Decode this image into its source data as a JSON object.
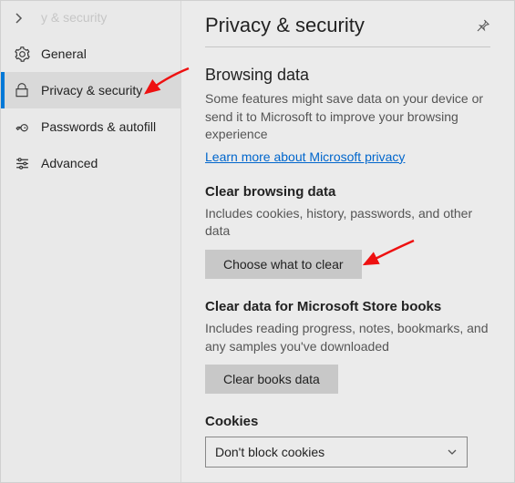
{
  "sidebar": {
    "ghost_title": "y & security",
    "items": [
      {
        "label": "General"
      },
      {
        "label": "Privacy & security"
      },
      {
        "label": "Passwords & autofill"
      },
      {
        "label": "Advanced"
      }
    ]
  },
  "header": {
    "title": "Privacy & security"
  },
  "browsing": {
    "heading": "Browsing data",
    "description": "Some features might save data on your device or send it to Microsoft to improve your browsing experience",
    "link": "Learn more about Microsoft privacy"
  },
  "clear": {
    "heading": "Clear browsing data",
    "description": "Includes cookies, history, passwords, and other data",
    "button": "Choose what to clear"
  },
  "books": {
    "heading": "Clear data for Microsoft Store books",
    "description": "Includes reading progress, notes, bookmarks, and any samples you've downloaded",
    "button": "Clear books data"
  },
  "cookies": {
    "heading": "Cookies",
    "selected": "Don't block cookies"
  }
}
